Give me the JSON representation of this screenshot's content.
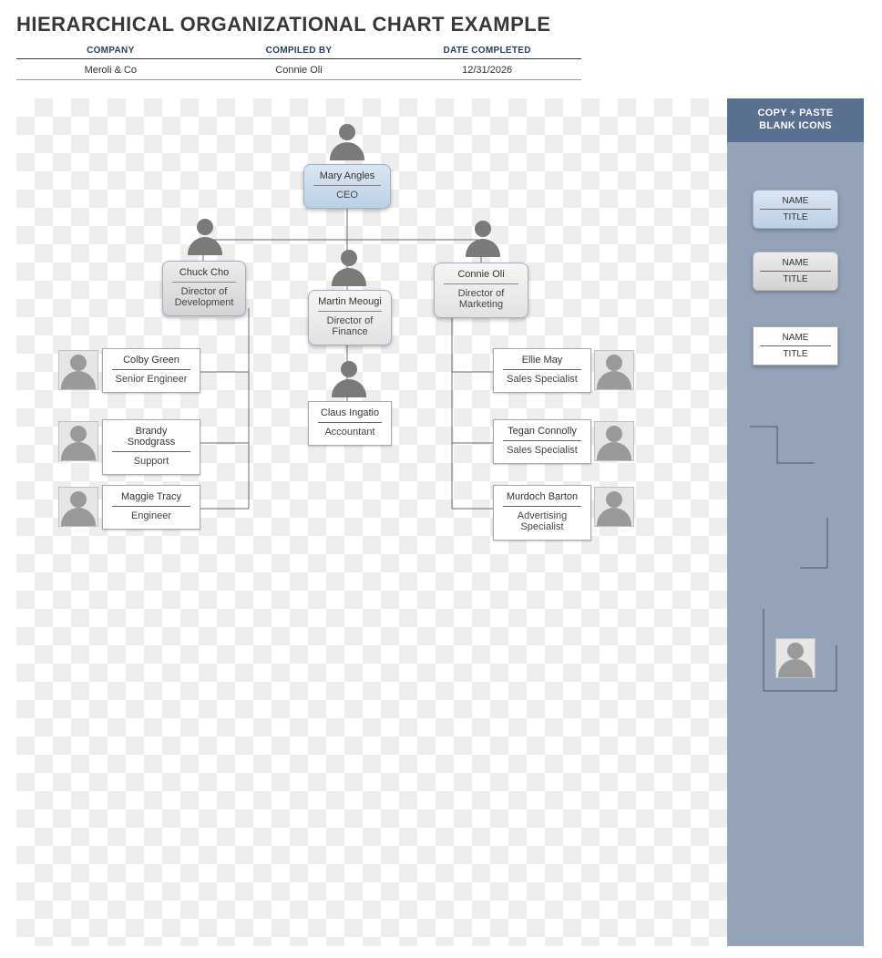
{
  "header": {
    "title": "HIERARCHICAL ORGANIZATIONAL CHART EXAMPLE",
    "columns": {
      "company": "COMPANY",
      "compiled_by": "COMPILED BY",
      "date_completed": "DATE COMPLETED"
    },
    "values": {
      "company": "Meroli & Co",
      "compiled_by": "Connie Oli",
      "date_completed": "12/31/2026"
    }
  },
  "sidebar": {
    "heading_line1": "COPY + PASTE",
    "heading_line2": "BLANK ICONS",
    "sample_name": "NAME",
    "sample_title": "TITLE"
  },
  "chart_data": {
    "type": "org_chart",
    "root": {
      "name": "Mary Angles",
      "title": "CEO"
    },
    "directors": [
      {
        "name": "Chuck Cho",
        "title": "Director of Development"
      },
      {
        "name": "Martin Meougi",
        "title": "Director of Finance"
      },
      {
        "name": "Connie Oli",
        "title": "Director of Marketing"
      }
    ],
    "dev_team": [
      {
        "name": "Colby Green",
        "title": "Senior Engineer"
      },
      {
        "name": "Brandy Snodgrass",
        "title": "Support"
      },
      {
        "name": "Maggie Tracy",
        "title": "Engineer"
      }
    ],
    "finance_team": [
      {
        "name": "Claus Ingatio",
        "title": "Accountant"
      }
    ],
    "marketing_team": [
      {
        "name": "Ellie May",
        "title": "Sales Specialist"
      },
      {
        "name": "Tegan Connolly",
        "title": "Sales Specialist"
      },
      {
        "name": "Murdoch Barton",
        "title": "Advertising Specialist"
      }
    ]
  }
}
